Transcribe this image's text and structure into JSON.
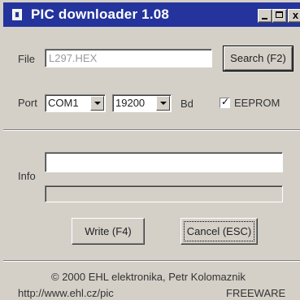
{
  "window": {
    "title": "PIC downloader 1.08",
    "icons": {
      "app": "app-icon",
      "minimize": "minimize-icon",
      "maximize": "maximize-icon",
      "close": "close-icon"
    },
    "close_glyph": "x"
  },
  "file": {
    "label": "File",
    "value": "L297.HEX",
    "search_button": "Search (F2)"
  },
  "port": {
    "label": "Port",
    "port_value": "COM1",
    "baud_value": "19200",
    "baud_unit": "Bd",
    "eeprom_label": "EEPROM",
    "eeprom_checked": true,
    "check_glyph": "✓"
  },
  "info": {
    "label": "Info",
    "text": "",
    "progress": 0
  },
  "actions": {
    "write": "Write (F4)",
    "cancel": "Cancel (ESC)"
  },
  "footer": {
    "copyright": "© 2000 EHL elektronika, Petr Kolomaznik",
    "url": "http://www.ehl.cz/pic",
    "license": "FREEWARE"
  },
  "colors": {
    "titlebar": "#24349c",
    "face": "#d4d0c8"
  }
}
